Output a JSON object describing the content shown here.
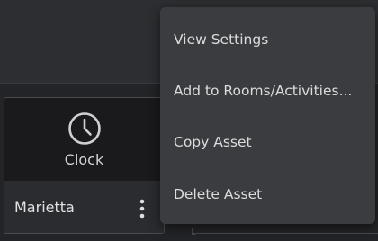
{
  "card": {
    "thumbnail_label": "Clock",
    "name": "Marietta",
    "icon": "clock-icon",
    "more_icon": "more-vertical-icon"
  },
  "context_menu": {
    "items": [
      {
        "label": "View Settings"
      },
      {
        "label": "Add to Rooms/Activities..."
      },
      {
        "label": "Copy Asset"
      },
      {
        "label": "Delete Asset"
      }
    ]
  },
  "colors": {
    "background": "#2d2e31",
    "menu_background": "#3b3c40",
    "text": "#dcdcdc"
  }
}
